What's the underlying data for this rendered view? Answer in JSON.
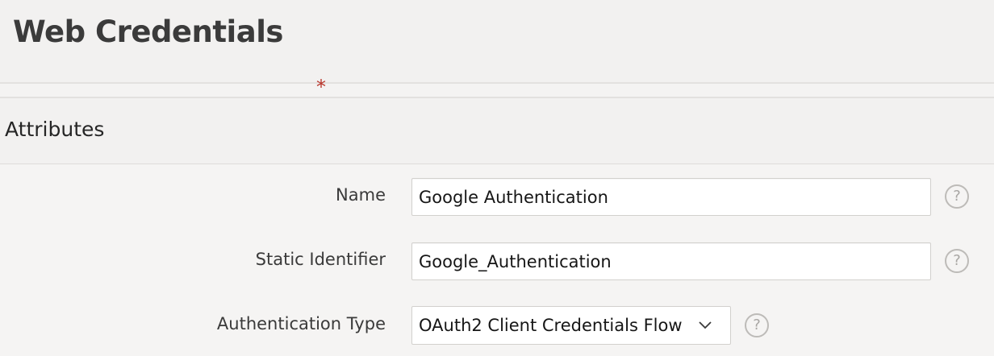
{
  "page": {
    "title": "Web Credentials"
  },
  "region": {
    "title": "Attributes"
  },
  "fields": {
    "name": {
      "required_mark": "*",
      "label": "Name",
      "value": "Google Authentication",
      "help_icon": "question-circle-icon",
      "help_glyph": "?"
    },
    "static_identifier": {
      "label": "Static Identifier",
      "value": "Google_Authentication",
      "help_icon": "question-circle-icon",
      "help_glyph": "?"
    },
    "authentication_type": {
      "label": "Authentication Type",
      "selected": "OAuth2 Client Credentials Flow",
      "dropdown_icon": "chevron-down-icon",
      "help_icon": "question-circle-icon",
      "help_glyph": "?"
    }
  },
  "colors": {
    "required": "#b8352b",
    "background": "#f4f3f2",
    "input_border": "#d2d0cd"
  }
}
